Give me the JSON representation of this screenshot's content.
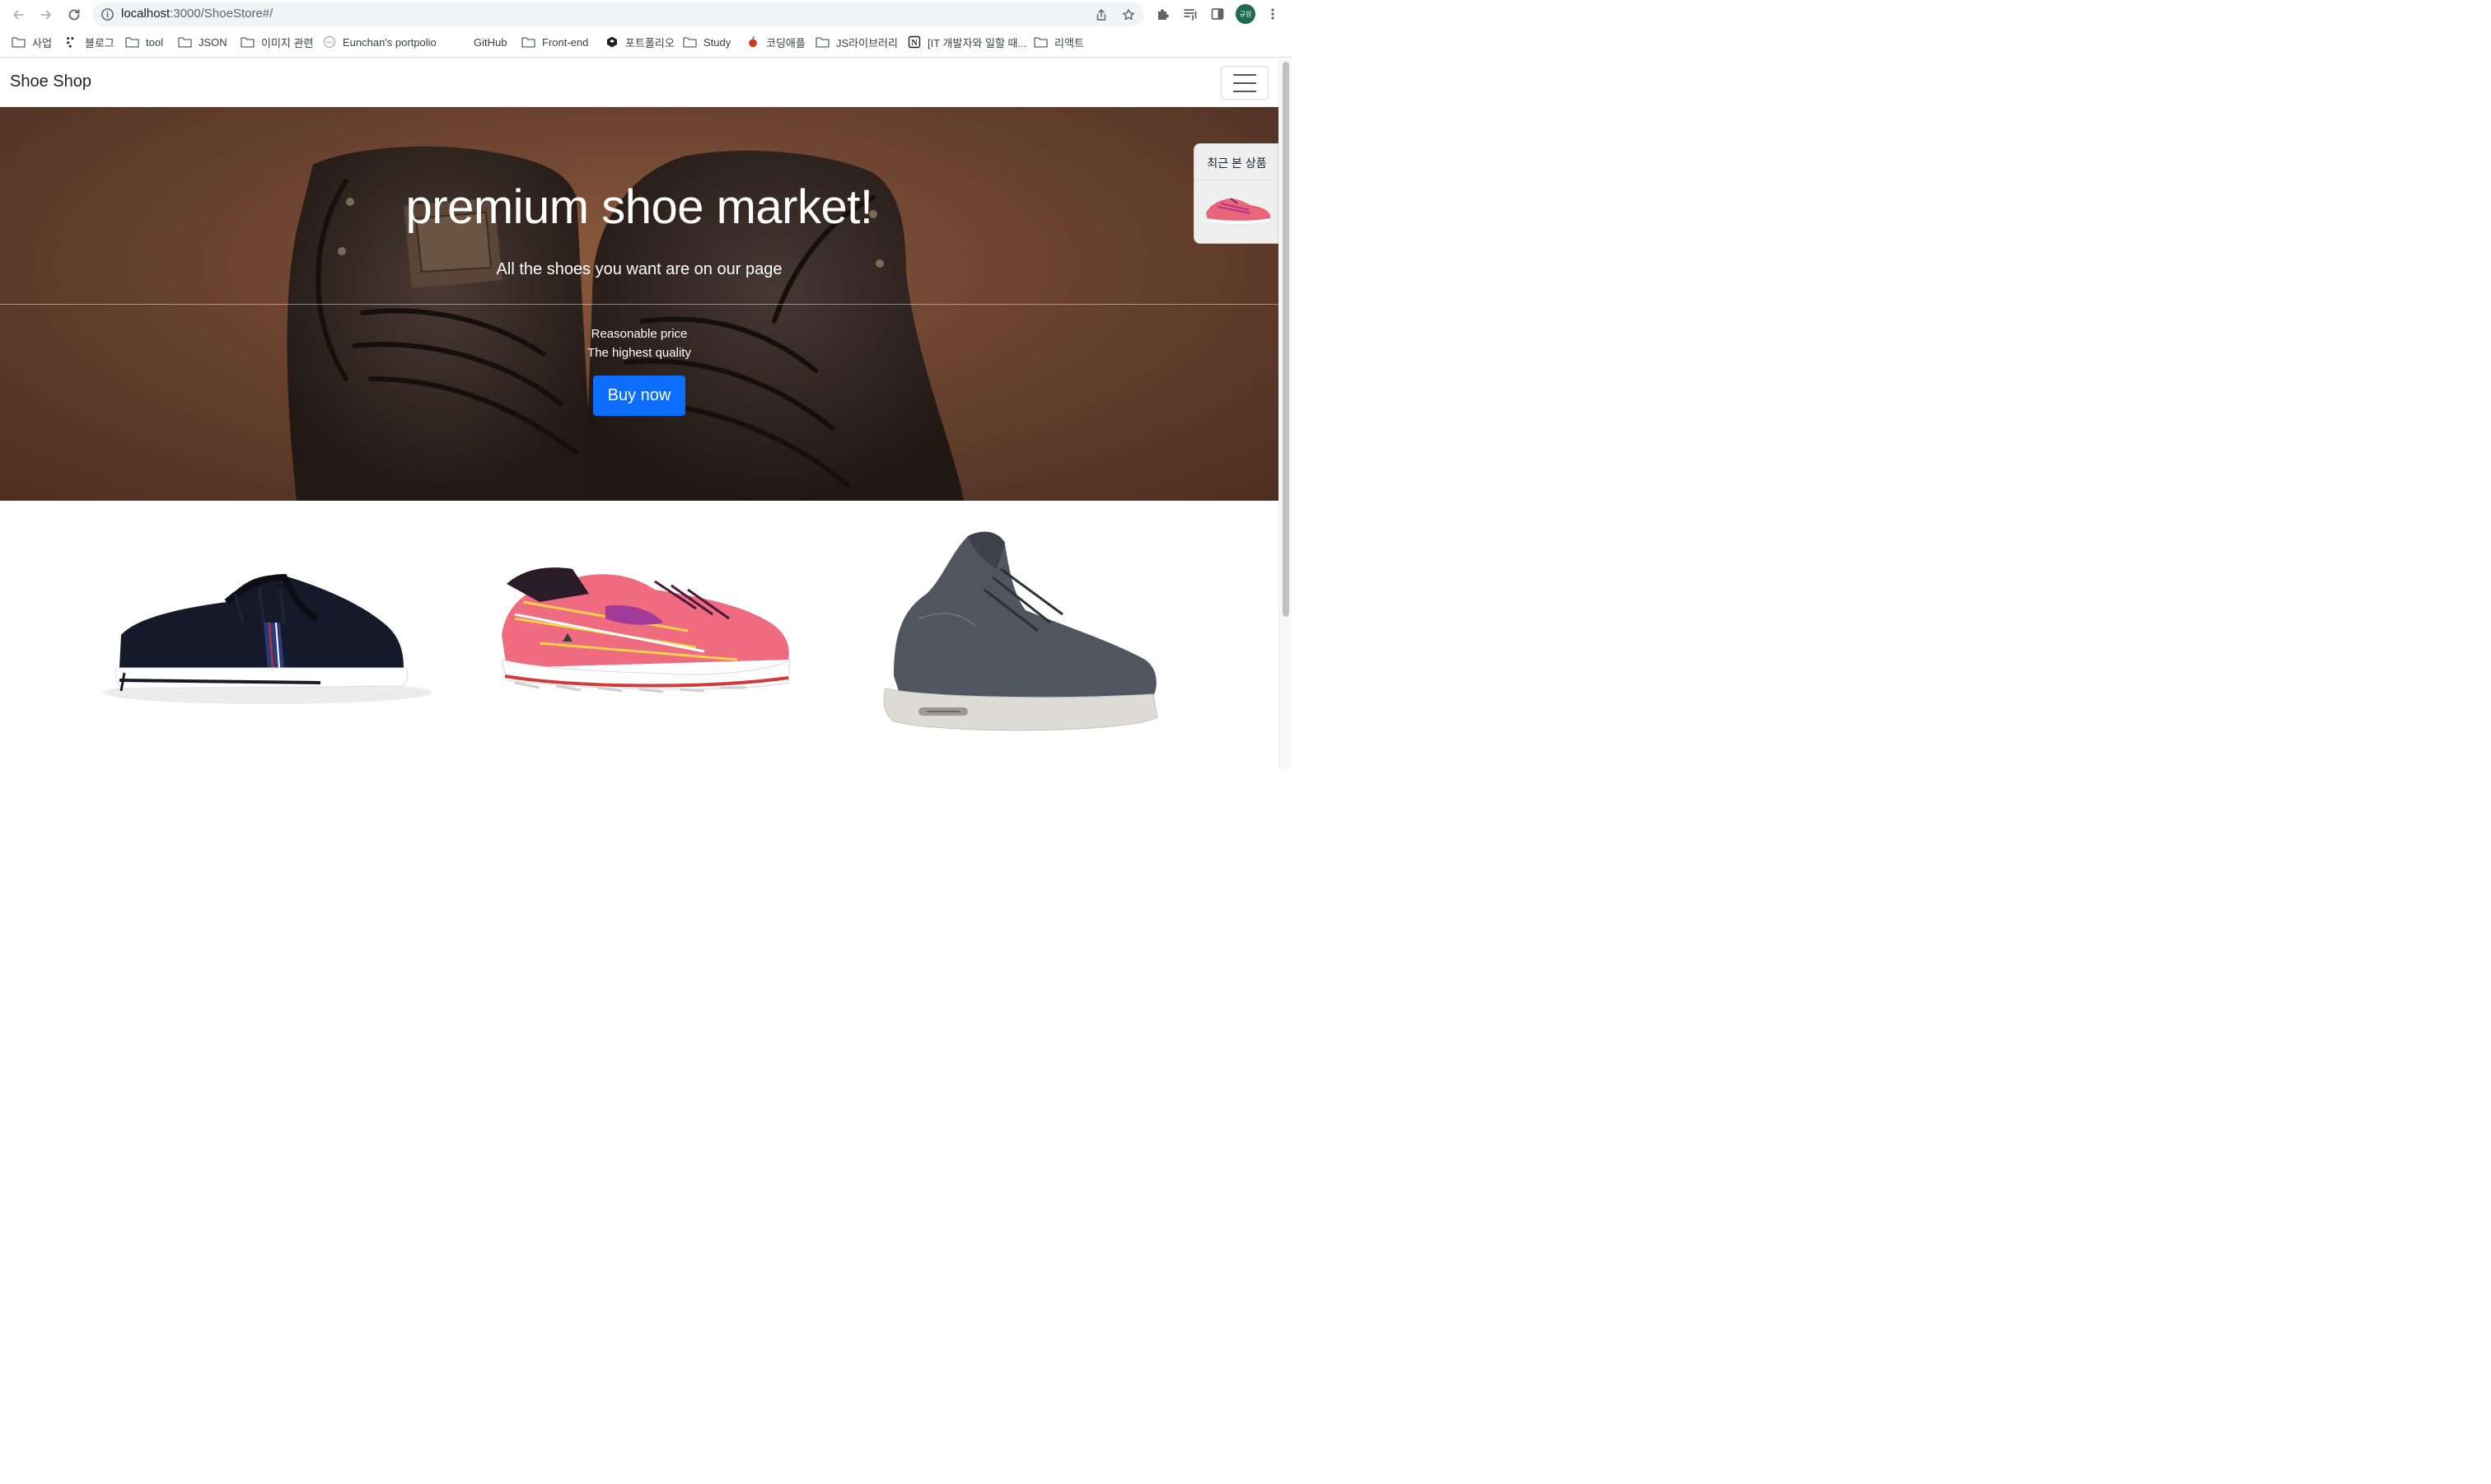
{
  "browser": {
    "url_host": "localhost",
    "url_path": ":3000/ShoeStore#/",
    "profile_label": "규원",
    "bookmarks": [
      {
        "label": "사업",
        "icon": "folder-icon"
      },
      {
        "label": "블로그",
        "icon": "dots-icon"
      },
      {
        "label": "tool",
        "icon": "folder-icon"
      },
      {
        "label": "JSON",
        "icon": "folder-icon"
      },
      {
        "label": "이미지 관련",
        "icon": "folder-icon"
      },
      {
        "label": "Eunchan's portpolio",
        "icon": "site-icon"
      },
      {
        "label": "GitHub",
        "icon": "github-icon"
      },
      {
        "label": "Front-end",
        "icon": "folder-icon"
      },
      {
        "label": "포트폴리오",
        "icon": "codepen-icon"
      },
      {
        "label": "Study",
        "icon": "folder-icon"
      },
      {
        "label": "코딩애플",
        "icon": "apple-icon"
      },
      {
        "label": "JS라이브러리",
        "icon": "folder-icon"
      },
      {
        "label": "[IT 개발자와 일할 때...",
        "icon": "notion-icon"
      },
      {
        "label": "리액트",
        "icon": "folder-icon"
      }
    ]
  },
  "navbar": {
    "brand": "Shoe Shop"
  },
  "hero": {
    "title": "premium shoe market!",
    "subtitle": "All the shoes you want are on our page",
    "line1": "Reasonable price",
    "line2": "The highest quality",
    "button": "Buy now"
  },
  "recent": {
    "title": "최근 본 상품"
  },
  "colors": {
    "primary": "#0d6efd",
    "hero_brown": "#6b4330"
  }
}
